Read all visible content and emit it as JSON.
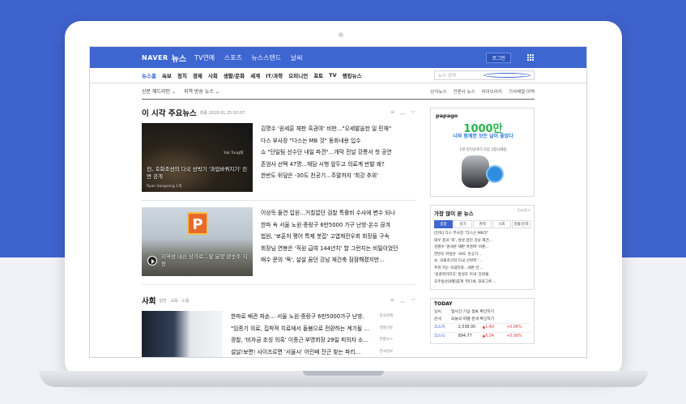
{
  "header": {
    "logo": "NAVER",
    "logo_news": "뉴스",
    "links": [
      "TV연예",
      "스포츠",
      "뉴스스탠드",
      "날씨"
    ],
    "login_label": "로그인"
  },
  "menu": {
    "items": [
      "뉴스홈",
      "속보",
      "정치",
      "경제",
      "사회",
      "생활/문화",
      "세계",
      "IT/과학",
      "오피니언",
      "포토",
      "TV",
      "랭킹뉴스"
    ],
    "search_placeholder": "뉴스 검색"
  },
  "subnav": {
    "left": [
      "신문 헤드라인",
      "지역 방송 뉴스"
    ],
    "right": [
      "상식뉴스",
      "언론사 뉴스",
      "라이브러리",
      "기사배열 이력"
    ]
  },
  "main_news": {
    "title": "이 시각 주요뉴스",
    "timestamp": "최종 2018.01.25 02:07",
    "block1": {
      "image_caption": "日, 호화조선의 다국 선박기 '과업바꿔지기' 진면 공개",
      "image_credit": "Ryan Sangsang 1개",
      "image_tag": "Yuk Tung태",
      "headlines": [
        "김명수 '원세훈 재판 흑권여' 비판…\"오세발을한 일 민재\"",
        "다스 부사장 \"다스는 MB 것\" 동화내용 입수",
        "쇼 \"단일팀 선수단 내일 파견\"…개막 전날 강릉서 첫 공연",
        "존엄사 선택 47명...재담 시행 앞두고 의료계 반발 왜?",
        "한반도 뒤덮은 -30도 찬공기…주말까지 '최강 추위'"
      ]
    },
    "block2": {
      "image_caption": "지역성 내신 상가로…앞 분양 판숫주 지장",
      "sign_letter": "P",
      "headlines": [
        "이상득 돌연 입원…거칠없던 검찰 특활비 수사에 변수 되나",
        "한파 속 서울 노원·중랑구 6만5000 가구 난방·온수 끊겨",
        "법원, '보훈처 평어 특제 붓잡' 고엽제전우회 회장들 구속",
        "회장님 연봉은 '직원 급여 144년치' 할 그런지는 비밀이었던",
        "매수 문의 '뚝', 살살 꿈던 강남 재건축 잠잠해졌지만…"
      ]
    }
  },
  "society": {
    "title": "사회",
    "subtabs": "일반 · 교육 · 노동",
    "headlines": [
      {
        "text": "한파로 배관 파손… 서울 노원·중랑구 6만5000가구 난방.",
        "source": "한국경제"
      },
      {
        "text": "\"임종기 의료, 집착적 치료에서 돌봄으로 전환하는 계기될 …",
        "source": "경향신문"
      },
      {
        "text": "경찰, '비자금 조성 의혹' 이중근 부영회장 29일 피의자 소…",
        "source": "연합뉴스"
      },
      {
        "text": "설날!보면! 사이즈르면 '서울시' 어린배 잔근 찾는 파리…",
        "source": "한국일보"
      }
    ]
  },
  "ad": {
    "brand": "papago",
    "big_text": "1000만",
    "text": "너와 함께한 모든 날이 좋았다",
    "small": "1천 만다운로드기념 3형시베용"
  },
  "ranking": {
    "title": "가장 많이 본 뉴스",
    "more": "Cur/1>",
    "tabs": [
      "종합",
      "정치",
      "경제",
      "사회",
      "생활/문화"
    ],
    "items": [
      "[단독] 다스 부사장 \"다스는 MB것\"",
      "대우 종의 '쪽', 살살 끌던 강남 재건…",
      "김명수 '원세훈 재판 흑권여' 비판…",
      "한반도 뒤덮은 -30도 찬공기…",
      "쇼, 의료조선의 다국 선박파 '…",
      "추워 지는 호대전최…세폰 언…",
      "'실골외이러고' 정성호 이내 '강원물.",
      "호주동산[8월]휴계 '파다세, 프로그트…"
    ]
  },
  "today": {
    "title": "TODAY",
    "weather_label": "날씨",
    "weather_text": "일시간·기상 정보 확인하기",
    "misc_label": "운세",
    "misc_text": "오늘의 띠별 운세 확인하기",
    "stocks": [
      {
        "name": "코스피",
        "value": "2,538.00",
        "change": "▲1.40",
        "pct": "+0.06%"
      },
      {
        "name": "코스닥",
        "value": "894.77",
        "change": "▲6.34",
        "pct": "+0.09%"
      }
    ]
  },
  "colors": {
    "brand_blue": "#3e66d1",
    "background_blue": "#3f63cc"
  }
}
